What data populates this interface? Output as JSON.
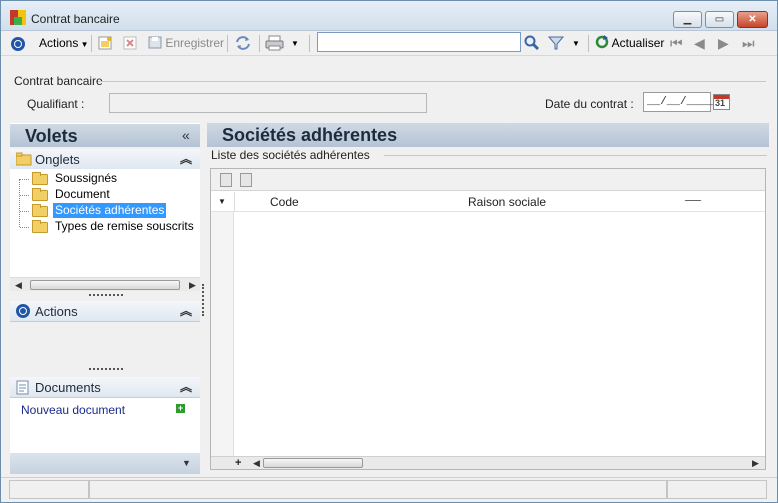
{
  "window": {
    "title": "Contrat bancaire"
  },
  "toolbar": {
    "actions_label": "Actions",
    "save_label": "Enregistrer",
    "search_value": "",
    "refresh_label": "Actualiser"
  },
  "header": {
    "section_title": "Contrat bancaire",
    "qualifiant_label": "Qualifiant :",
    "date_label": "Date du contrat :",
    "date_value": "__/__/____",
    "calendar_day": "31"
  },
  "volets": {
    "title": "Volets",
    "collapse_glyph": "«",
    "onglets": {
      "title": "Onglets",
      "items": [
        {
          "label": "Soussignés"
        },
        {
          "label": "Document"
        },
        {
          "label": "Sociétés adhérentes"
        },
        {
          "label": "Types de remise souscrits"
        }
      ],
      "selected_index": 2
    },
    "actions_title": "Actions",
    "documents": {
      "title": "Documents",
      "new_document": "Nouveau document"
    }
  },
  "main": {
    "title": "Sociétés adhérentes",
    "list_caption": "Liste des sociétés adhérentes",
    "columns": [
      "Code",
      "Raison sociale"
    ],
    "rows": []
  },
  "icons": {
    "app": "app-icon",
    "actions": "actions-ring-icon",
    "new": "new-record-icon",
    "delete": "delete-icon",
    "save": "save-icon",
    "sync": "sync-icon",
    "print": "print-icon",
    "search": "search-icon",
    "filter": "filter-icon",
    "refresh": "refresh-icon",
    "nav": [
      "first-icon",
      "previous-icon",
      "next-icon",
      "last-icon"
    ],
    "calendar": "calendar-icon",
    "folder": "folder-icon",
    "documents": "document-icon"
  },
  "colors": {
    "selection": "#3399ff",
    "header_band": "#b4c3d4",
    "nav_blue": "#2255a8"
  }
}
